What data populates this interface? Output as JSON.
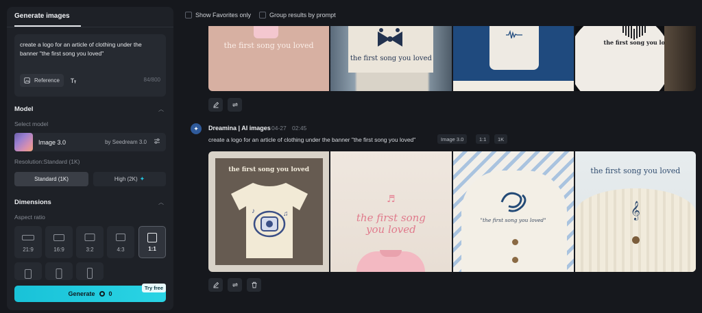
{
  "panel": {
    "tab_label": "Generate images",
    "prompt_text": "create a logo for an article of clothing under the banner \"the first song you loved\"",
    "reference_label": "Reference",
    "tt_icon": "text-format-icon",
    "char_count": "84/800",
    "model_section": "Model",
    "select_model_label": "Select model",
    "model_name": "Image 3.0",
    "model_by": "by Seedream 3.0",
    "resolution_label": "Resolution:Standard (1K)",
    "res_standard": "Standard (1K)",
    "res_high": "High (2K)",
    "dimensions_section": "Dimensions",
    "aspect_ratio_label": "Aspect ratio",
    "aspects": [
      "21:9",
      "16:9",
      "3:2",
      "4:3",
      "1:1"
    ],
    "selected_aspect": "1:1",
    "generate_label": "Generate",
    "generate_cost": "0",
    "try_free": "Try free"
  },
  "topbar": {
    "show_favorites": "Show Favorites only",
    "group_results": "Group results by prompt"
  },
  "top_row": {
    "tile1_text": "the first song you loved",
    "tile2_text": "the first song you loved",
    "tile4_text": "the first song you loved"
  },
  "generation": {
    "author": "Dreamina | AI images",
    "date": "04-27",
    "time": "02:45",
    "prompt": "create a logo for an article of clothing under the banner \"the first song you loved\"",
    "chips": [
      "Image 3.0",
      "1:1",
      "1K"
    ],
    "tile1_text": "the first song you loved",
    "tile2_line1": "the first song",
    "tile2_line2": "you loved",
    "tile3_text": "\"the first song you loved\"",
    "tile4_text": "the first song you loved"
  },
  "colors": {
    "accent": "#22c4e0",
    "background": "#16181d",
    "panel": "#1e2127"
  }
}
